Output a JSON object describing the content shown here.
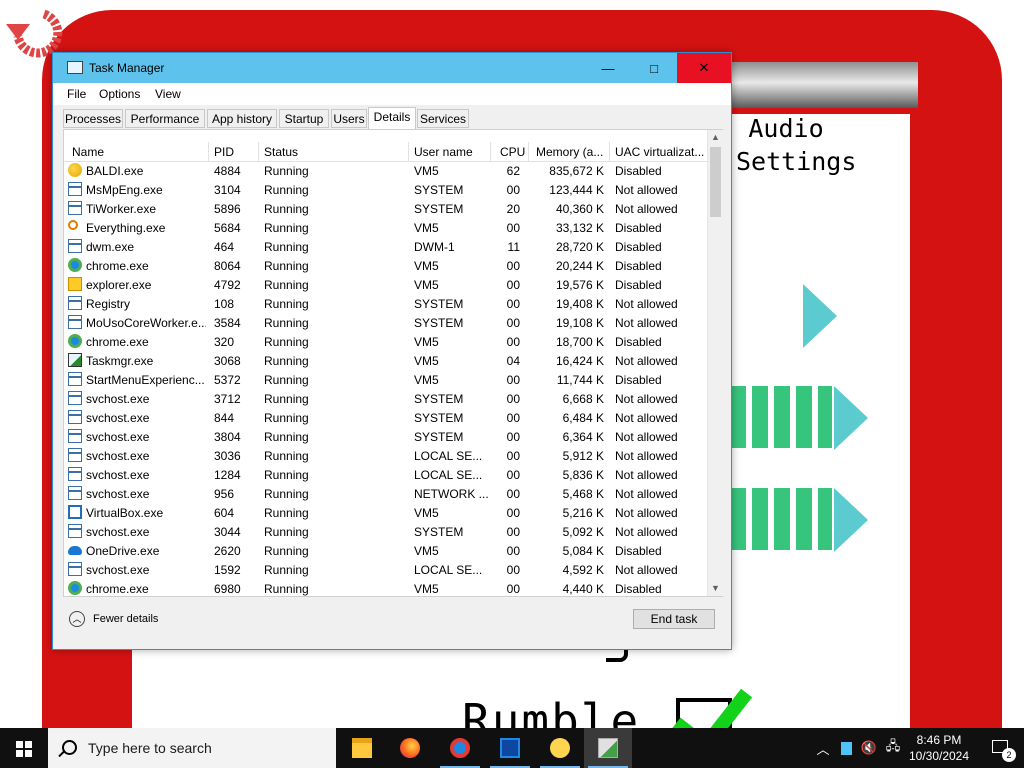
{
  "game": {
    "audio_title_line1": "Audio",
    "audio_title_line2": "Settings",
    "rumble_label": "Rumble"
  },
  "window": {
    "title": "Task Manager",
    "controls": {
      "minimize": "—",
      "maximize": "□",
      "close": "✕"
    }
  },
  "menu": [
    "File",
    "Options",
    "View"
  ],
  "tabs": [
    "Processes",
    "Performance",
    "App history",
    "Startup",
    "Users",
    "Details",
    "Services"
  ],
  "active_tab": "Details",
  "columns": [
    "Name",
    "PID",
    "Status",
    "User name",
    "CPU",
    "Memory (a...",
    "UAC virtualizat..."
  ],
  "rows": [
    {
      "name": "BALDI.exe",
      "pid": "4884",
      "status": "Running",
      "user": "VM5",
      "cpu": "62",
      "memory": "835,672 K",
      "uac": "Disabled",
      "icon": "baldi-icon"
    },
    {
      "name": "MsMpEng.exe",
      "pid": "3104",
      "status": "Running",
      "user": "SYSTEM",
      "cpu": "00",
      "memory": "123,444 K",
      "uac": "Not allowed",
      "icon": "generic-app-icon"
    },
    {
      "name": "TiWorker.exe",
      "pid": "5896",
      "status": "Running",
      "user": "SYSTEM",
      "cpu": "20",
      "memory": "40,360 K",
      "uac": "Not allowed",
      "icon": "generic-app-icon"
    },
    {
      "name": "Everything.exe",
      "pid": "5684",
      "status": "Running",
      "user": "VM5",
      "cpu": "00",
      "memory": "33,132 K",
      "uac": "Disabled",
      "icon": "magnifier-icon"
    },
    {
      "name": "dwm.exe",
      "pid": "464",
      "status": "Running",
      "user": "DWM-1",
      "cpu": "11",
      "memory": "28,720 K",
      "uac": "Disabled",
      "icon": "generic-app-icon"
    },
    {
      "name": "chrome.exe",
      "pid": "8064",
      "status": "Running",
      "user": "VM5",
      "cpu": "00",
      "memory": "20,244 K",
      "uac": "Disabled",
      "icon": "chrome-icon"
    },
    {
      "name": "explorer.exe",
      "pid": "4792",
      "status": "Running",
      "user": "VM5",
      "cpu": "00",
      "memory": "19,576 K",
      "uac": "Disabled",
      "icon": "folder-icon"
    },
    {
      "name": "Registry",
      "pid": "108",
      "status": "Running",
      "user": "SYSTEM",
      "cpu": "00",
      "memory": "19,408 K",
      "uac": "Not allowed",
      "icon": "generic-app-icon"
    },
    {
      "name": "MoUsoCoreWorker.e...",
      "pid": "3584",
      "status": "Running",
      "user": "SYSTEM",
      "cpu": "00",
      "memory": "19,108 K",
      "uac": "Not allowed",
      "icon": "generic-app-icon"
    },
    {
      "name": "chrome.exe",
      "pid": "320",
      "status": "Running",
      "user": "VM5",
      "cpu": "00",
      "memory": "18,700 K",
      "uac": "Disabled",
      "icon": "chrome-icon"
    },
    {
      "name": "Taskmgr.exe",
      "pid": "3068",
      "status": "Running",
      "user": "VM5",
      "cpu": "04",
      "memory": "16,424 K",
      "uac": "Not allowed",
      "icon": "task-manager-icon"
    },
    {
      "name": "StartMenuExperienc...",
      "pid": "5372",
      "status": "Running",
      "user": "VM5",
      "cpu": "00",
      "memory": "11,744 K",
      "uac": "Disabled",
      "icon": "generic-app-icon"
    },
    {
      "name": "svchost.exe",
      "pid": "3712",
      "status": "Running",
      "user": "SYSTEM",
      "cpu": "00",
      "memory": "6,668 K",
      "uac": "Not allowed",
      "icon": "generic-app-icon"
    },
    {
      "name": "svchost.exe",
      "pid": "844",
      "status": "Running",
      "user": "SYSTEM",
      "cpu": "00",
      "memory": "6,484 K",
      "uac": "Not allowed",
      "icon": "generic-app-icon"
    },
    {
      "name": "svchost.exe",
      "pid": "3804",
      "status": "Running",
      "user": "SYSTEM",
      "cpu": "00",
      "memory": "6,364 K",
      "uac": "Not allowed",
      "icon": "generic-app-icon"
    },
    {
      "name": "svchost.exe",
      "pid": "3036",
      "status": "Running",
      "user": "LOCAL SE...",
      "cpu": "00",
      "memory": "5,912 K",
      "uac": "Not allowed",
      "icon": "generic-app-icon"
    },
    {
      "name": "svchost.exe",
      "pid": "1284",
      "status": "Running",
      "user": "LOCAL SE...",
      "cpu": "00",
      "memory": "5,836 K",
      "uac": "Not allowed",
      "icon": "generic-app-icon"
    },
    {
      "name": "svchost.exe",
      "pid": "956",
      "status": "Running",
      "user": "NETWORK ...",
      "cpu": "00",
      "memory": "5,468 K",
      "uac": "Not allowed",
      "icon": "generic-app-icon"
    },
    {
      "name": "VirtualBox.exe",
      "pid": "604",
      "status": "Running",
      "user": "VM5",
      "cpu": "00",
      "memory": "5,216 K",
      "uac": "Not allowed",
      "icon": "virtualbox-icon"
    },
    {
      "name": "svchost.exe",
      "pid": "3044",
      "status": "Running",
      "user": "SYSTEM",
      "cpu": "00",
      "memory": "5,092 K",
      "uac": "Not allowed",
      "icon": "generic-app-icon"
    },
    {
      "name": "OneDrive.exe",
      "pid": "2620",
      "status": "Running",
      "user": "VM5",
      "cpu": "00",
      "memory": "5,084 K",
      "uac": "Disabled",
      "icon": "onedrive-icon"
    },
    {
      "name": "svchost.exe",
      "pid": "1592",
      "status": "Running",
      "user": "LOCAL SE...",
      "cpu": "00",
      "memory": "4,592 K",
      "uac": "Not allowed",
      "icon": "generic-app-icon"
    },
    {
      "name": "chrome.exe",
      "pid": "6980",
      "status": "Running",
      "user": "VM5",
      "cpu": "00",
      "memory": "4,440 K",
      "uac": "Disabled",
      "icon": "chrome-icon"
    }
  ],
  "footer": {
    "fewer_details": "Fewer details",
    "end_task": "End task"
  },
  "taskbar": {
    "search_placeholder": "Type here to search",
    "pinned": [
      "file-explorer-icon",
      "firefox-icon",
      "chrome-icon",
      "virtualbox-icon",
      "baldi-icon",
      "task-manager-icon"
    ],
    "time": "8:46 PM",
    "date": "10/30/2024",
    "notification_count": "2"
  },
  "colors": {
    "titlebar": "#5ec3ec",
    "close_button": "#e81123",
    "game_red": "#d51212",
    "taskbar": "#101010"
  }
}
